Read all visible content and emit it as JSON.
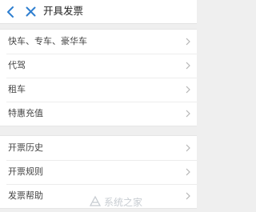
{
  "header": {
    "title": "开具发票"
  },
  "groups": [
    {
      "items": [
        {
          "label": "快车、专车、豪华车"
        },
        {
          "label": "代驾"
        },
        {
          "label": "租车"
        },
        {
          "label": "特惠充值"
        }
      ]
    },
    {
      "items": [
        {
          "label": "开票历史"
        },
        {
          "label": "开票规则"
        },
        {
          "label": "发票帮助"
        }
      ]
    }
  ],
  "watermark": {
    "text": "系统之家"
  },
  "colors": {
    "accent": "#2f7fd0",
    "background": "#efefef",
    "row_background": "#ffffff",
    "chevron": "#b5b5b5"
  },
  "icons": {
    "back": "back-arrow-icon",
    "close": "close-icon",
    "row_arrow": "chevron-right-icon"
  }
}
